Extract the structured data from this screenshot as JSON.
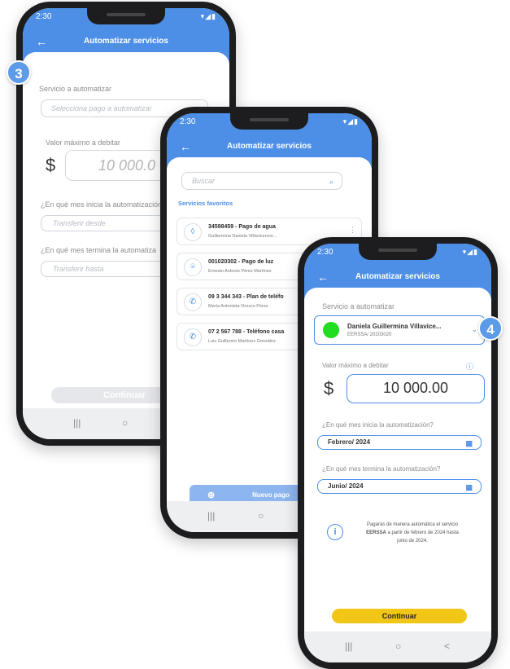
{
  "status": {
    "time": "2:30",
    "time_mid": "2:30",
    "time_front": "2:30",
    "signal": "▾◢▮"
  },
  "app": {
    "title": "Automatizar servicios",
    "back_icon": "arrow-left-icon"
  },
  "colors": {
    "primary": "#4d8fe6",
    "accent_yellow": "#f2c617",
    "badge": "#5b9be8",
    "avatar_green": "#22dd22"
  },
  "steps": {
    "left": "3",
    "right": "4"
  },
  "screen_left": {
    "service_label": "Servicio a automatizar",
    "service_placeholder": "Selecciona pago a automatizar",
    "max_label": "Valor máximo a debitar",
    "currency": "$",
    "amount": "10 000.0",
    "start_label": "¿En qué mes inicia la automatización",
    "start_placeholder": "Transferir desde",
    "end_label": "¿En qué mes termina la automatiza",
    "end_placeholder": "Transferir hasta",
    "continue": "Continuar"
  },
  "screen_mid": {
    "search_placeholder": "Buscar",
    "favorites_title": "Servicios favoritos",
    "items": [
      {
        "title": "34598459 - Pago de agua",
        "subtitle": "Guillermina Daniela Villavicencio...",
        "icon": "water-drop-icon",
        "glyph": "◊"
      },
      {
        "title": "001020302 - Pago de luz",
        "subtitle": "Ernesto Antonio Pérez Martínez",
        "icon": "location-pin-icon",
        "glyph": "⌾"
      },
      {
        "title": "09 3 344 343 - Plan de teléfo",
        "subtitle": "María Antonieta Orozco Pérez",
        "icon": "phone-icon",
        "glyph": "✆"
      },
      {
        "title": "07 2 567 788 - Teléfono casa",
        "subtitle": "Luis Guillermo Martínez González",
        "icon": "phone-icon",
        "glyph": "✆"
      }
    ],
    "new_payment": "Nuevo pago"
  },
  "screen_right": {
    "service_label": "Servicio a automatizar",
    "service_name": "Daniela Guillermina Villavice...",
    "service_sub": "EERSSA/ 20203020",
    "max_label": "Valor máximo a debitar",
    "currency": "$",
    "amount": "10 000.00",
    "start_label": "¿En qué mes inicia la automatización?",
    "start_value": "Febrero/ 2024",
    "end_label": "¿En qué mes termina la automatización?",
    "end_value": "Junio/ 2024",
    "info_prefix": "Pagarás de manera automática el servicio",
    "info_bold": "EERSSA",
    "info_suffix": "a partir de febrero de 2024 hasta junio de 2024.",
    "continue": "Continuar"
  },
  "navbar": {
    "recents": "|||",
    "home": "○",
    "back": "<"
  }
}
